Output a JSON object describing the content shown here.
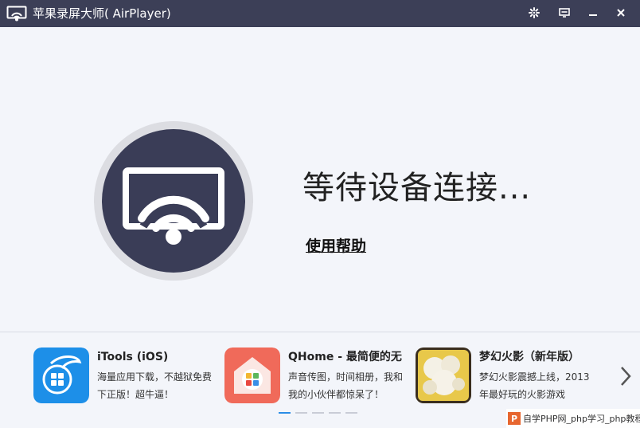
{
  "titlebar": {
    "title": "苹果录屏大师( AirPlayer)",
    "icons": [
      "airplay-logo-icon",
      "settings-icon",
      "feedback-icon",
      "minimize-icon",
      "close-icon"
    ]
  },
  "main": {
    "status_text": "等待设备连接...",
    "help_link": "使用帮助"
  },
  "promo": {
    "apps": [
      {
        "title": "iTools (iOS)",
        "desc": "海量应用下载，不越狱免费下正版！超牛逼！"
      },
      {
        "title": "QHome - 最简便的无",
        "desc": "声音传图，时间相册，我和我的小伙伴都惊呆了！"
      },
      {
        "title": "梦幻火影（新年版）",
        "desc": "梦幻火影震撼上线，2013年最好玩的火影游戏"
      }
    ],
    "page_count": 5,
    "active_page": 1
  },
  "watermark": {
    "logo": "P",
    "text": "自学PHP网_php学习_php教程"
  },
  "colors": {
    "titlebar_bg": "#3c3f57",
    "status_circle": "#3a3d57",
    "accent_blue": "#2b8de6"
  }
}
